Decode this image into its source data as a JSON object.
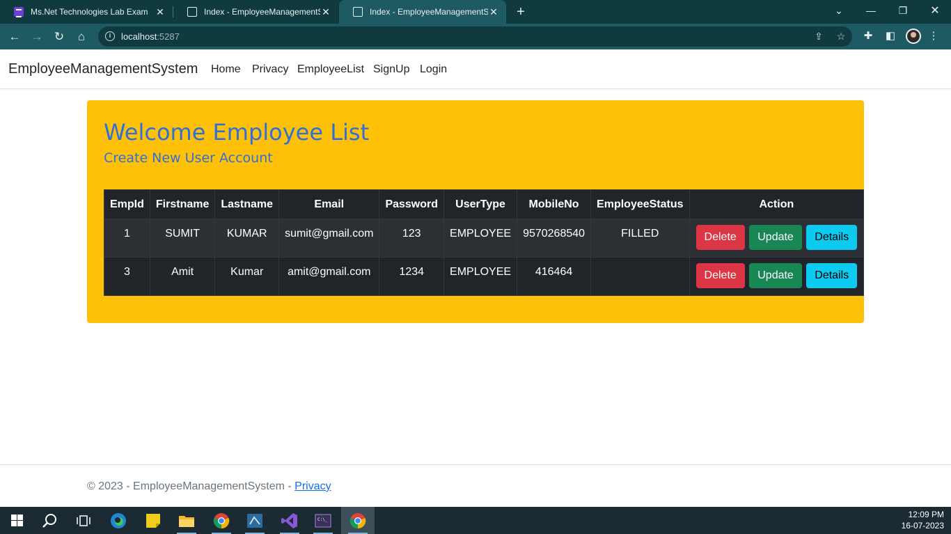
{
  "browser": {
    "tabs": [
      {
        "title": "Ms.Net Technologies Lab Exam",
        "active": false
      },
      {
        "title": "Index - EmployeeManagementSy",
        "active": false
      },
      {
        "title": "Index - EmployeeManagementSy",
        "active": true
      }
    ],
    "url_host": "localhost",
    "url_port": ":5287"
  },
  "site": {
    "brand": "EmployeeManagementSystem",
    "nav": [
      "Home",
      "Privacy",
      "EmployeeList",
      "SignUp",
      "Login"
    ]
  },
  "main": {
    "title": "Welcome Employee List",
    "create_link": "Create New User Account",
    "table": {
      "headers": [
        "EmpId",
        "Firstname",
        "Lastname",
        "Email",
        "Password",
        "UserType",
        "MobileNo",
        "EmployeeStatus",
        "Action"
      ],
      "rows": [
        {
          "EmpId": "1",
          "Firstname": "SUMIT",
          "Lastname": "KUMAR",
          "Email": "sumit@gmail.com",
          "Password": "123",
          "UserType": "EMPLOYEE",
          "MobileNo": "9570268540",
          "EmployeeStatus": "FILLED"
        },
        {
          "EmpId": "3",
          "Firstname": "Amit",
          "Lastname": "Kumar",
          "Email": "amit@gmail.com",
          "Password": "1234",
          "UserType": "EMPLOYEE",
          "MobileNo": "416464",
          "EmployeeStatus": ""
        }
      ],
      "actions": {
        "delete": "Delete",
        "update": "Update",
        "details": "Details"
      }
    }
  },
  "footer": {
    "text": "© 2023 - EmployeeManagementSystem - ",
    "privacy_link": "Privacy"
  },
  "taskbar": {
    "time": "12:09 PM",
    "date": "16-07-2023"
  },
  "colors": {
    "panel": "#ffc107",
    "heading": "#2f6fd6",
    "table_bg": "#212529",
    "delete": "#dc3545",
    "update": "#198754",
    "details": "#0dcaf0"
  }
}
